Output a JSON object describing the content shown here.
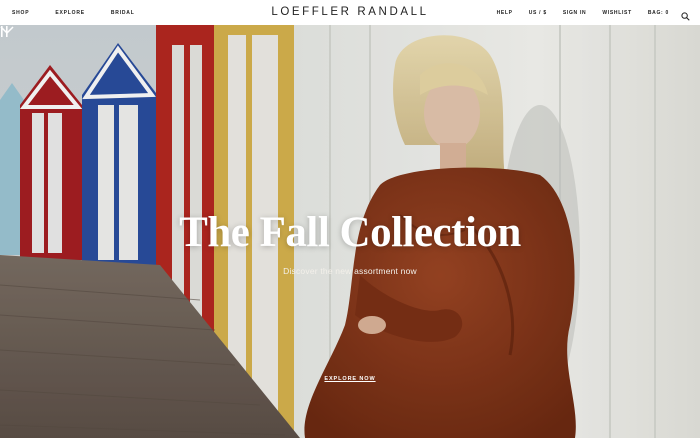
{
  "header": {
    "nav_left": [
      "SHOP",
      "EXPLORE",
      "BRIDAL"
    ],
    "logo": "LOEFFLER RANDALL",
    "nav_right": [
      "HELP",
      "US / $",
      "SIGN IN",
      "WISHLIST",
      "BAG: 0"
    ],
    "search_icon": "search-icon"
  },
  "hero": {
    "headline": "The Fall Collection",
    "subline": "Discover the new assortment now",
    "cta": "EXPLORE NOW",
    "scroll_icon": "chevron-down-icon",
    "pause_icon": "pause-icon"
  },
  "colors": {
    "dress": "#8a3a1c",
    "hair": "#e8d7a8",
    "wall": "#f2f2ee",
    "boardwalk": "#6b5d52"
  }
}
